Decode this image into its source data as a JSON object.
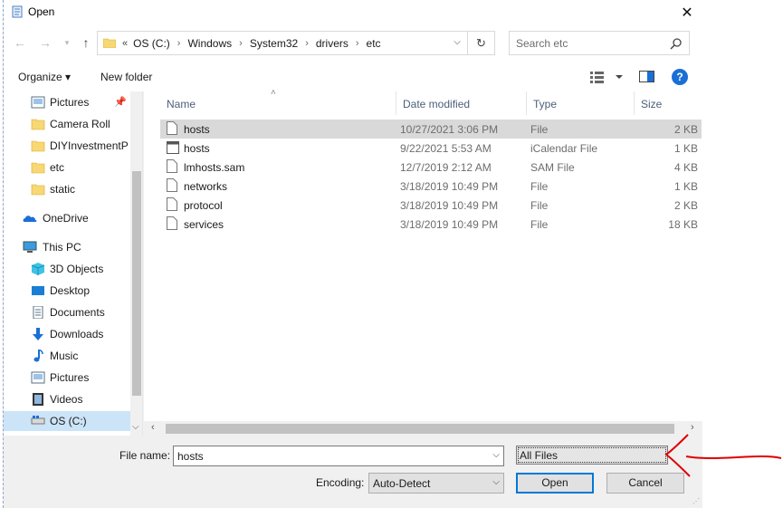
{
  "window": {
    "title": "Open",
    "close_glyph": "✕"
  },
  "address": {
    "overflow": "«",
    "crumbs": [
      "OS (C:)",
      "Windows",
      "System32",
      "drivers",
      "etc"
    ],
    "search_placeholder": "Search etc"
  },
  "toolbar": {
    "organize": "Organize ▾",
    "new_folder": "New folder",
    "help": "?"
  },
  "nav": {
    "items": [
      {
        "label": "Pictures",
        "icon": "pictures-icon",
        "pinned": true
      },
      {
        "label": "Camera Roll",
        "icon": "folder-icon"
      },
      {
        "label": "DIYInvestmentPr",
        "icon": "folder-icon"
      },
      {
        "label": "etc",
        "icon": "folder-icon"
      },
      {
        "label": "static",
        "icon": "folder-icon"
      },
      {
        "label": "OneDrive",
        "icon": "onedrive-icon"
      },
      {
        "label": "This PC",
        "icon": "this-pc-icon"
      },
      {
        "label": "3D Objects",
        "icon": "3d-objects-icon"
      },
      {
        "label": "Desktop",
        "icon": "desktop-icon"
      },
      {
        "label": "Documents",
        "icon": "documents-icon"
      },
      {
        "label": "Downloads",
        "icon": "downloads-icon"
      },
      {
        "label": "Music",
        "icon": "music-icon"
      },
      {
        "label": "Pictures",
        "icon": "pictures-icon"
      },
      {
        "label": "Videos",
        "icon": "videos-icon"
      },
      {
        "label": "OS (C:)",
        "icon": "drive-icon",
        "selected": true
      }
    ]
  },
  "columns": {
    "name": "Name",
    "date": "Date modified",
    "type": "Type",
    "size": "Size"
  },
  "files": [
    {
      "name": "hosts",
      "date": "10/27/2021 3:06 PM",
      "type": "File",
      "size": "2 KB",
      "icon": "file-icon",
      "selected": true
    },
    {
      "name": "hosts",
      "date": "9/22/2021 5:53 AM",
      "type": "iCalendar File",
      "size": "1 KB",
      "icon": "calendar-file-icon"
    },
    {
      "name": "lmhosts.sam",
      "date": "12/7/2019 2:12 AM",
      "type": "SAM File",
      "size": "4 KB",
      "icon": "file-icon"
    },
    {
      "name": "networks",
      "date": "3/18/2019 10:49 PM",
      "type": "File",
      "size": "1 KB",
      "icon": "file-icon"
    },
    {
      "name": "protocol",
      "date": "3/18/2019 10:49 PM",
      "type": "File",
      "size": "2 KB",
      "icon": "file-icon"
    },
    {
      "name": "services",
      "date": "3/18/2019 10:49 PM",
      "type": "File",
      "size": "18 KB",
      "icon": "file-icon"
    }
  ],
  "bottom": {
    "file_name_label": "File name:",
    "file_name_value": "hosts",
    "filter_value": "All Files",
    "encoding_label": "Encoding:",
    "encoding_value": "Auto-Detect",
    "open": "Open",
    "cancel": "Cancel"
  },
  "colors": {
    "selection": "#cce4f7",
    "row_selected": "#d9d9d9",
    "accent": "#0078d7",
    "annotation": "#e00000"
  }
}
